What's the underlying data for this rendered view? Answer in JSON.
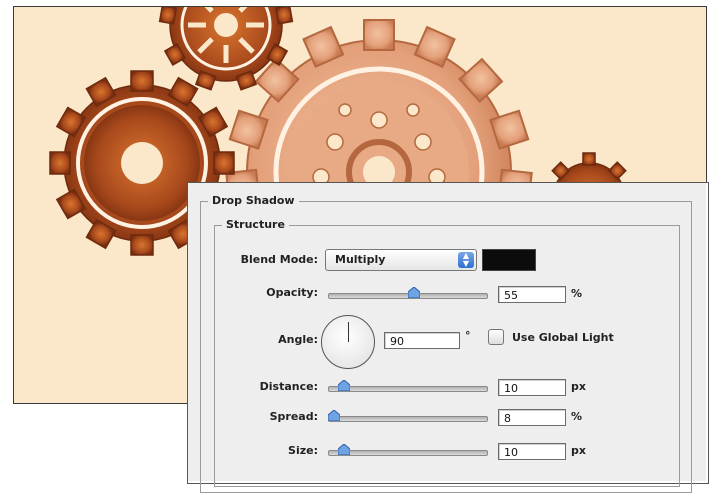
{
  "panel": {
    "title": "Drop Shadow",
    "group": "Structure",
    "blend_mode": {
      "label": "Blend Mode:",
      "value": "Multiply",
      "color": "#0c0c0c"
    },
    "opacity": {
      "label": "Opacity:",
      "value": "55",
      "unit": "%",
      "slider_fraction": 0.55
    },
    "angle": {
      "label": "Angle:",
      "value": "90",
      "unit": "°",
      "global_light_label": "Use Global Light",
      "global_light_checked": false
    },
    "distance": {
      "label": "Distance:",
      "value": "10",
      "unit": "px",
      "slider_fraction": 0.07
    },
    "spread": {
      "label": "Spread:",
      "value": "8",
      "unit": "%",
      "slider_fraction": 0.0
    },
    "size": {
      "label": "Size:",
      "value": "10",
      "unit": "px",
      "slider_fraction": 0.07
    }
  },
  "colors": {
    "canvas_bg": "#fbe7c9",
    "gear_dark": "#a8491c",
    "gear_light": "#e3a07a"
  }
}
